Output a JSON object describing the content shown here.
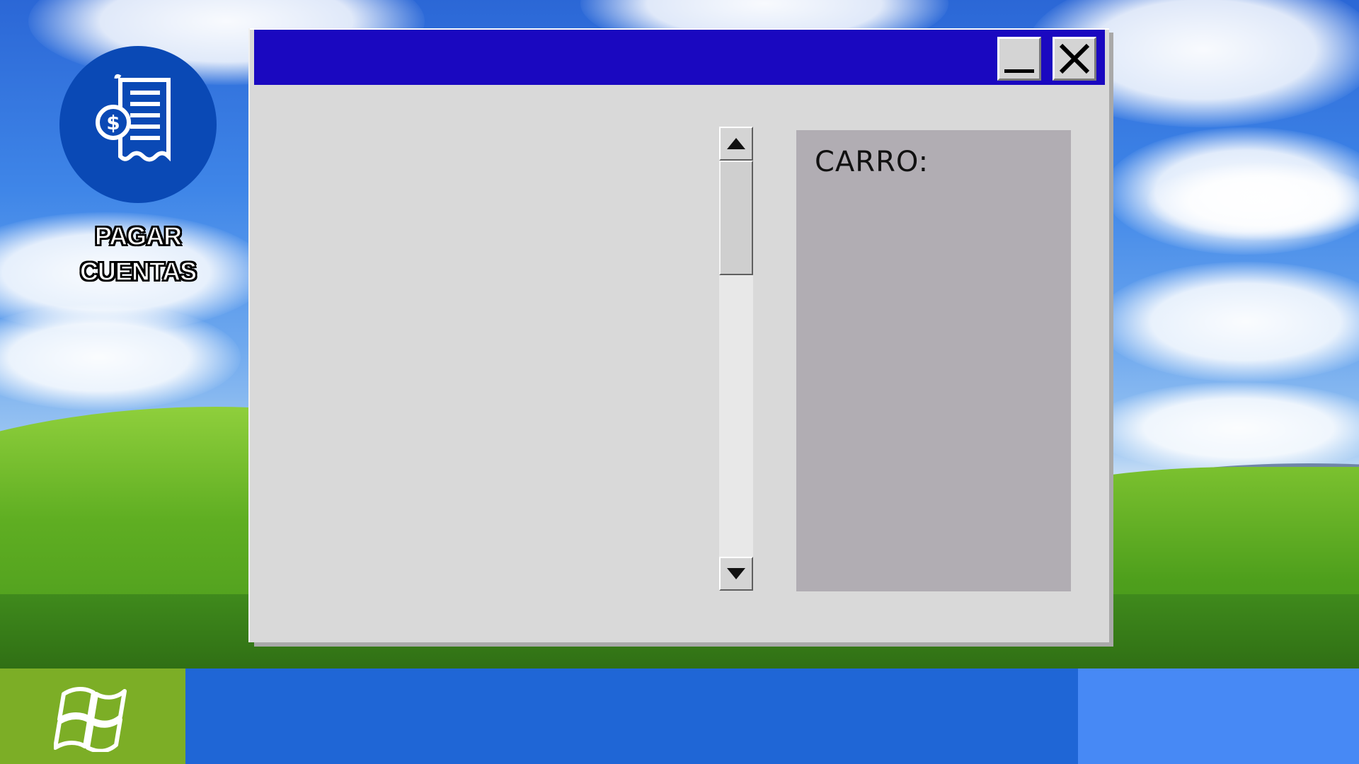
{
  "desktop": {
    "icon": {
      "label_line1": "PAGAR",
      "label_line2": "CUENTAS",
      "icon_name": "bill-receipt-dollar-icon",
      "circle_color": "#0a49b5"
    }
  },
  "window": {
    "titlebar_color": "#1a08c0",
    "minimize_icon": "minimize-icon",
    "close_icon": "close-icon",
    "cart": {
      "title": "CARRO:",
      "panel_color": "#b1adb3"
    },
    "scrollbar": {
      "up_icon": "arrow-up-icon",
      "down_icon": "arrow-down-icon",
      "position": 0
    }
  },
  "taskbar": {
    "color": "#1f66d6",
    "start_color": "#7cae26",
    "tray_color": "#4789f5",
    "start_icon": "windows-logo-icon"
  }
}
